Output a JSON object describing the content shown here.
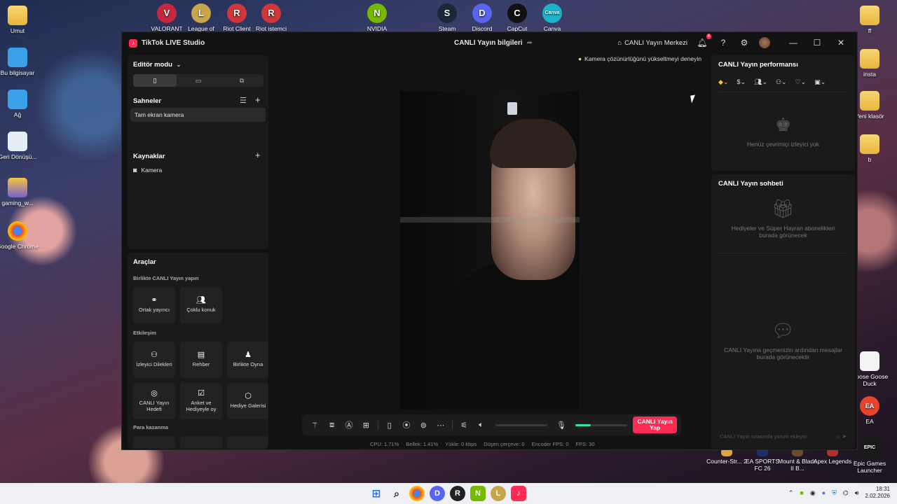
{
  "desktop": {
    "top_icons": [
      {
        "label": "VALORANT",
        "color": "#c4283d",
        "glyph": "V"
      },
      {
        "label": "League of",
        "color": "#c7a54a",
        "glyph": "L"
      },
      {
        "label": "Riot Client",
        "color": "#d13639",
        "glyph": "R"
      },
      {
        "label": "Riot istemci",
        "color": "#d13639",
        "glyph": "R"
      },
      {
        "label": "NVIDIA",
        "color": "#76b900",
        "glyph": "N"
      },
      {
        "label": "Steam",
        "color": "#1b2838",
        "glyph": "S"
      },
      {
        "label": "Discord",
        "color": "#5865f2",
        "glyph": "D"
      },
      {
        "label": "CapCut",
        "color": "#111111",
        "glyph": "C"
      },
      {
        "label": "Canva",
        "color": "#1cb2c9",
        "glyph": "Canva"
      }
    ],
    "left_icons": [
      {
        "label": "Umut",
        "type": "folder"
      },
      {
        "label": "Bu bilgisayar",
        "type": "computer"
      },
      {
        "label": "Ağ",
        "type": "network"
      },
      {
        "label": "Geri Dönüşü...",
        "type": "recycle"
      },
      {
        "label": "gaming_w...",
        "type": "image"
      },
      {
        "label": "Google Chrome",
        "type": "chrome"
      }
    ],
    "right_icons": [
      {
        "label": "ff",
        "type": "folder"
      },
      {
        "label": "insta",
        "type": "folder"
      },
      {
        "label": "Yeni klasör",
        "type": "folder"
      },
      {
        "label": "b",
        "type": "folder"
      },
      {
        "label": "Goose Goose Duck",
        "type": "app"
      },
      {
        "label": "EA",
        "type": "ea"
      },
      {
        "label": "Epic Games Launcher",
        "type": "epic"
      }
    ],
    "bottom_icons": [
      {
        "label": "Counter-Str... 2",
        "color": "#d9a441"
      },
      {
        "label": "EA SPORTS FC 26",
        "color": "#1a2f6b"
      },
      {
        "label": "Mount & Blade II B...",
        "color": "#6b4b2a"
      },
      {
        "label": "Apex Legends",
        "color": "#b0302a"
      }
    ]
  },
  "window": {
    "app_name": "TikTok LIVE Studio",
    "center_title": "CANLI Yayın bilgileri",
    "live_center": "CANLI Yayın Merkezi",
    "notif_count": "4"
  },
  "left": {
    "editor_mode": "Editör modu",
    "scenes_title": "Sahneler",
    "scene_item": "Tam ekran kamera",
    "sources_title": "Kaynaklar",
    "source_item": "Kamera",
    "tools_title": "Araçlar",
    "collab_label": "Birlikte CANLI Yayın yapın",
    "collab_tools": [
      "Ortak yayıncı",
      "Çoklu konuk"
    ],
    "interaction_label": "Etkileşim",
    "interaction_tools": [
      "İzleyici Dilekleri",
      "Rehber",
      "Birlikte Oyna",
      "CANLI Yayın Hedefi",
      "Anket ve Hediyeyle oy",
      "Hediye Galerisi"
    ],
    "monetize_label": "Para kazanma"
  },
  "preview": {
    "hint": "Kamera çözünürlüğünü yükseltmeyi deneyin"
  },
  "controlbar": {
    "go_live": "CANLI Yayın Yap",
    "mic_level": 0.3
  },
  "stats": {
    "cpu": "CPU:  1.71%",
    "memory": "Bellek:  1.41%",
    "upload": "Yükle:  0 kbps",
    "dropped": "Düşen çerçeve:  0",
    "encoder": "Encoder FPS:  0",
    "fps": "FPS:  30"
  },
  "right": {
    "performance_title": "CANLI Yayın performansı",
    "no_viewers": "Henüz çevrimiçi izleyici yok",
    "chat_title": "CANLI Yayın sohbeti",
    "gifts_empty": "Hediyeler ve Süper Hayran abonelikleri burada görünecek",
    "messages_empty": "CANLI Yayına geçmenizin ardından mesajlar burada görünecektir",
    "chat_placeholder": "CANLI Yayın sırasında yorum ekleyin"
  },
  "taskbar": {
    "time": "18:31",
    "date": "2.02.2026"
  }
}
